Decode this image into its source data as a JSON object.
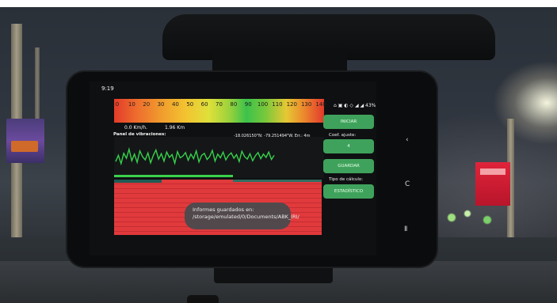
{
  "status": {
    "time": "9:19",
    "right": "⌂ ▣ ◐ ◇ ◢ ◢ 43%"
  },
  "speedbar": {
    "ticks": [
      "0",
      "10",
      "20",
      "30",
      "40",
      "50",
      "60",
      "70",
      "80",
      "90",
      "100",
      "110",
      "120",
      "130",
      "140"
    ]
  },
  "readouts": {
    "speed": "0.0 Km/h.",
    "distance": "1.96 Km",
    "coords": "-18.026150\"N; -79.251494\"W. Err.: 4m",
    "panel_label": "Panel de vibraciones:"
  },
  "sidebar": {
    "iniciar": "INICIAR",
    "coef_label": "Coef. ajuste:",
    "coef_value": "4",
    "guardar": "GUARDAR",
    "tipo_label": "Tipo de cálculo:",
    "tipo_value": "ESTADÍSTICO"
  },
  "toast": "Informes guardados en: /storage/emulated/0/Documents/ABK_IRI/",
  "colors": {
    "accent": "#3fa25c",
    "alert": "#e13a3c"
  },
  "vibration_series": [
    40,
    55,
    35,
    60,
    48,
    70,
    42,
    58,
    38,
    66,
    52,
    44,
    61,
    37,
    55,
    68,
    46,
    59,
    41,
    63,
    50,
    57,
    36,
    64,
    49,
    53,
    62,
    43,
    58,
    47,
    66,
    39,
    55,
    60,
    45,
    52,
    67,
    41,
    58,
    49,
    63,
    44,
    55,
    61,
    48,
    57,
    40,
    65,
    52,
    46,
    59,
    42,
    54,
    62,
    47,
    58,
    50,
    63,
    45,
    55
  ]
}
